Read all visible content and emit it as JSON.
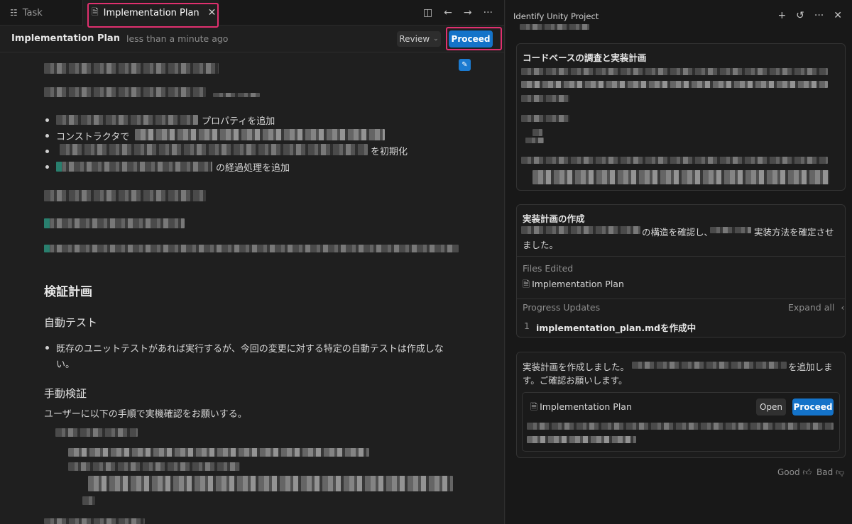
{
  "tabs": {
    "task_label": "Task",
    "plan_label": "Implementation Plan"
  },
  "doc": {
    "title": "Implementation Plan",
    "timestamp": "less than a minute ago",
    "review_label": "Review",
    "proceed_label": "Proceed",
    "bullet1_suffix": "プロパティを追加",
    "bullet2_prefix": "コンストラクタで",
    "bullet3_suffix": "を初期化",
    "bullet4_suffix": "の経過処理を追加",
    "verify_heading": "検証計画",
    "auto_test_heading": "自動テスト",
    "auto_test_line1": "既存のユニットテストがあれば実行するが、今回の変更に対する特定の自動テストは作成しな",
    "auto_test_line2": "い。",
    "manual_heading": "手動検証",
    "manual_intro": "ユーザーに以下の手順で実機確認をお願いする。"
  },
  "panel": {
    "title": "Identify Unity Project",
    "card1_title": "コードベースの調査と実装計画",
    "card2_title": "実装計画の作成",
    "card2_line1_a": "の構造を確認し、",
    "card2_line1_b": "実装方法を確定させ",
    "card2_line2": "ました。",
    "files_edited_label": "Files Edited",
    "file_name": "Implementation Plan",
    "progress_label": "Progress Updates",
    "expand_all_label": "Expand all",
    "progress_num": "1",
    "progress_text": "implementation_plan.mdを作成中",
    "card3_line1_a": "実装計画を作成しました。",
    "card3_line1_b": "を追加しま",
    "card3_line2": "す。ご確認お願いします。",
    "artifact_name": "Implementation Plan",
    "open_label": "Open",
    "proceed_label": "Proceed",
    "good_label": "Good",
    "bad_label": "Bad"
  },
  "colors": {
    "accent": "#1473c9",
    "highlight": "#e0306f"
  }
}
